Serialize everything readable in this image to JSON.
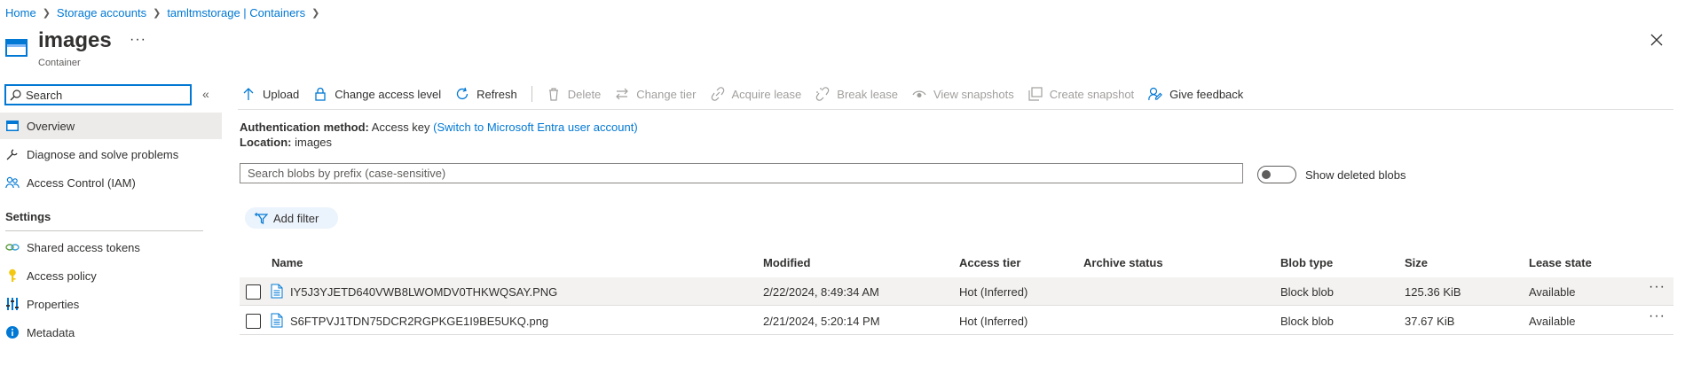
{
  "breadcrumb": {
    "items": [
      "Home",
      "Storage accounts",
      "tamltmstorage | Containers"
    ]
  },
  "header": {
    "title": "images",
    "subtitle": "Container",
    "more": "···"
  },
  "nav": {
    "search_placeholder": "Search",
    "collapse": "«",
    "items": [
      {
        "label": "Overview",
        "icon": "overview-icon"
      },
      {
        "label": "Diagnose and solve problems",
        "icon": "wrench-icon"
      },
      {
        "label": "Access Control (IAM)",
        "icon": "people-icon"
      }
    ],
    "settings_heading": "Settings",
    "settings_items": [
      {
        "label": "Shared access tokens",
        "icon": "link-icon"
      },
      {
        "label": "Access policy",
        "icon": "key-icon"
      },
      {
        "label": "Properties",
        "icon": "properties-icon"
      },
      {
        "label": "Metadata",
        "icon": "info-icon"
      }
    ]
  },
  "toolbar": {
    "upload": "Upload",
    "change_access": "Change access level",
    "refresh": "Refresh",
    "delete": "Delete",
    "change_tier": "Change tier",
    "acquire_lease": "Acquire lease",
    "break_lease": "Break lease",
    "view_snapshots": "View snapshots",
    "create_snapshot": "Create snapshot",
    "give_feedback": "Give feedback"
  },
  "info": {
    "auth_label": "Authentication method:",
    "auth_value": "Access key",
    "auth_link": "(Switch to Microsoft Entra user account)",
    "location_label": "Location:",
    "location_value": "images"
  },
  "prefix_search": {
    "placeholder": "Search blobs by prefix (case-sensitive)"
  },
  "show_deleted": {
    "label": "Show deleted blobs",
    "checked": false
  },
  "filter": {
    "label": "Add filter"
  },
  "table": {
    "columns": [
      "Name",
      "Modified",
      "Access tier",
      "Archive status",
      "Blob type",
      "Size",
      "Lease state"
    ],
    "rows": [
      {
        "name": "IY5J3YJETD640VWB8LWOMDV0THKWQSAY.PNG",
        "modified": "2/22/2024, 8:49:34 AM",
        "tier": "Hot (Inferred)",
        "archive": "",
        "type": "Block blob",
        "size": "125.36 KiB",
        "lease": "Available"
      },
      {
        "name": "S6FTPVJ1TDN75DCR2RGPKGE1I9BE5UKQ.png",
        "modified": "2/21/2024, 5:20:14 PM",
        "tier": "Hot (Inferred)",
        "archive": "",
        "type": "Block blob",
        "size": "37.67 KiB",
        "lease": "Available"
      }
    ],
    "row_more": "···"
  },
  "colors": {
    "accent": "#0078d4",
    "disabled": "#a19f9d",
    "selected_row": "#f3f2f1"
  }
}
